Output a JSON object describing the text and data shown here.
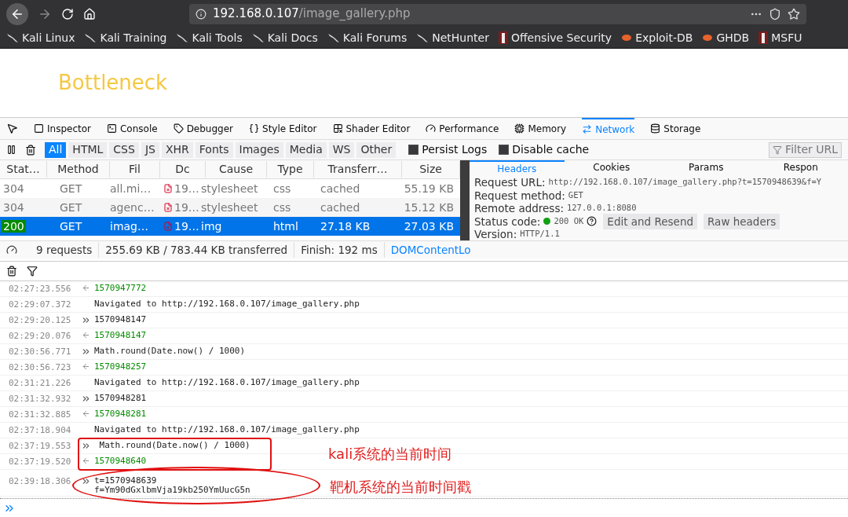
{
  "browser": {
    "url": {
      "host": "192.168.0.107",
      "path": "/image_gallery.php"
    },
    "bookmarks": [
      {
        "label": "Kali Linux",
        "kind": "kali"
      },
      {
        "label": "Kali Training",
        "kind": "kali"
      },
      {
        "label": "Kali Tools",
        "kind": "kali"
      },
      {
        "label": "Kali Docs",
        "kind": "kali"
      },
      {
        "label": "Kali Forums",
        "kind": "kali"
      },
      {
        "label": "NetHunter",
        "kind": "kali"
      },
      {
        "label": "Offensive Security",
        "kind": "offsec"
      },
      {
        "label": "Exploit-DB",
        "kind": "exploit"
      },
      {
        "label": "GHDB",
        "kind": "exploit"
      },
      {
        "label": "MSFU",
        "kind": "offsec"
      }
    ]
  },
  "page": {
    "heading": "Bottleneck"
  },
  "devtools": {
    "tabs": [
      {
        "label": "Inspector",
        "kind": "inspector",
        "selected": false
      },
      {
        "label": "Console",
        "kind": "console",
        "selected": false
      },
      {
        "label": "Debugger",
        "kind": "debugger",
        "selected": false
      },
      {
        "label": "Style Editor",
        "kind": "style",
        "selected": false
      },
      {
        "label": "Shader Editor",
        "kind": "shader",
        "selected": false
      },
      {
        "label": "Performance",
        "kind": "performance",
        "selected": false
      },
      {
        "label": "Memory",
        "kind": "memory",
        "selected": false
      },
      {
        "label": "Network",
        "kind": "network",
        "selected": true
      },
      {
        "label": "Storage",
        "kind": "storage",
        "selected": false
      }
    ],
    "filters": [
      {
        "label": "All",
        "selected": true
      },
      {
        "label": "HTML",
        "selected": false
      },
      {
        "label": "CSS",
        "selected": false
      },
      {
        "label": "JS",
        "selected": false
      },
      {
        "label": "XHR",
        "selected": false
      },
      {
        "label": "Fonts",
        "selected": false
      },
      {
        "label": "Images",
        "selected": false
      },
      {
        "label": "Media",
        "selected": false
      },
      {
        "label": "WS",
        "selected": false
      },
      {
        "label": "Other",
        "selected": false
      }
    ],
    "options": [
      {
        "label": "Persist Logs",
        "checked": false
      },
      {
        "label": "Disable cache",
        "checked": false
      }
    ],
    "filter_field": {
      "placeholder": "Filter URL"
    },
    "table": {
      "columns": [
        "Stat…",
        "Method",
        "Fil",
        "Dc",
        "Cause",
        "Type",
        "Transferr…",
        "Size"
      ],
      "rows": [
        {
          "status": "304",
          "kind": "cached",
          "method": "GET",
          "file": "all.mi…",
          "domain": "19…",
          "cause": "stylesheet",
          "type": "css",
          "transferred": "cached",
          "size": "55.19 KB",
          "selected": false
        },
        {
          "status": "304",
          "kind": "cached",
          "method": "GET",
          "file": "agenc…",
          "domain": "19…",
          "cause": "stylesheet",
          "type": "css",
          "transferred": "cached",
          "size": "15.12 KB",
          "selected": false
        },
        {
          "status": "200",
          "kind": "ok",
          "method": "GET",
          "file": "imag…",
          "domain": "19…",
          "cause": "img",
          "type": "html",
          "transferred": "27.18 KB",
          "size": "27.03 KB",
          "selected": true
        }
      ]
    },
    "summary": [
      "9 requests",
      "255.69 KB / 783.44 KB transferred",
      "Finish: 192 ms",
      "DOMContentLo"
    ],
    "details": {
      "tabs": [
        {
          "label": "Headers",
          "selected": true
        },
        {
          "label": "Cookies",
          "selected": false
        },
        {
          "label": "Params",
          "selected": false
        },
        {
          "label": "Respon",
          "selected": false
        }
      ],
      "fields": [
        {
          "label": "Request URL:",
          "value": "http://192.168.0.107/image_gallery.php?t=1570948639&f=Y"
        },
        {
          "label": "Request method:",
          "value": "GET"
        },
        {
          "label": "Remote address:",
          "value": "127.0.0.1:8080"
        },
        {
          "label": "Status code:",
          "value": "200 OK",
          "color": "#12a012"
        },
        {
          "label": "Version:",
          "value": "HTTP/1.1"
        }
      ],
      "buttons": [
        "Edit and Resend",
        "Raw headers"
      ]
    }
  },
  "console": {
    "rows": [
      {
        "time": "02:27:23.556",
        "kind": "result",
        "text": "1570947772"
      },
      {
        "time": "02:29:07.372",
        "kind": "navigation",
        "text": "Navigated to http://192.168.0.107/image_gallery.php"
      },
      {
        "time": "02:29:20.125",
        "kind": "input",
        "text": "1570948147"
      },
      {
        "time": "02:29:20.076",
        "kind": "result",
        "text": "1570948147"
      },
      {
        "time": "02:30:56.771",
        "kind": "input",
        "text": "Math.round(Date.now() / 1000)"
      },
      {
        "time": "02:30:56.723",
        "kind": "result",
        "text": "1570948257"
      },
      {
        "time": "02:31:21.226",
        "kind": "navigation",
        "text": "Navigated to http://192.168.0.107/image_gallery.php"
      },
      {
        "time": "02:31:32.932",
        "kind": "input",
        "text": "1570948281"
      },
      {
        "time": "02:31:32.885",
        "kind": "result",
        "text": "1570948281"
      },
      {
        "time": "02:37:18.904",
        "kind": "navigation",
        "text": "Navigated to http://192.168.0.107/image_gallery.php"
      },
      {
        "time": "02:37:19.553",
        "kind": "input",
        "text": " Math.round(Date.now() / 1000)"
      },
      {
        "time": "02:37:19.520",
        "kind": "result",
        "text": "1570948640"
      },
      {
        "time": "02:39:18.306",
        "kind": "input",
        "text": "t=1570948639\nf=Ym90dGxlbmVja19kb250YmUucG5n"
      }
    ],
    "annotations": [
      {
        "kind": "rect",
        "label": "kali系统的当前时间"
      },
      {
        "kind": "ellipse",
        "label": "靶机系统的当前时间戳"
      }
    ]
  }
}
